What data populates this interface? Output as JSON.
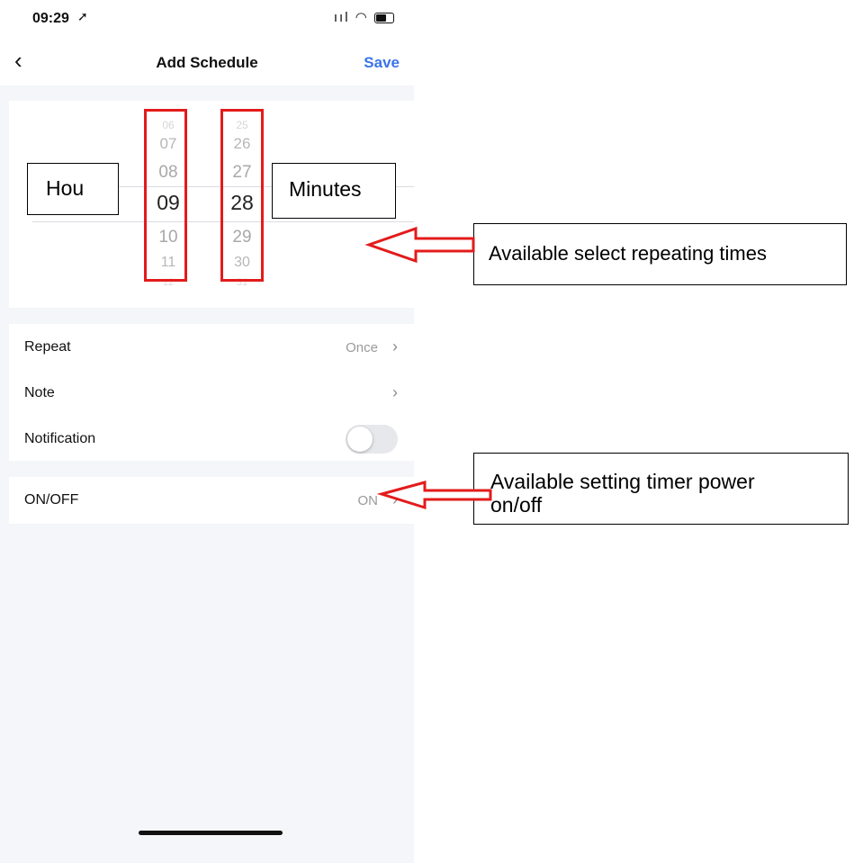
{
  "status_bar": {
    "time": "09:29",
    "location_icon": "location-arrow-icon",
    "signal_icon": "signal-icon",
    "wifi_icon": "wifi-icon",
    "battery_icon": "battery-icon"
  },
  "nav": {
    "back_icon": "chevron-left-icon",
    "title": "Add Schedule",
    "save": "Save"
  },
  "picker": {
    "hours": [
      "06",
      "07",
      "08",
      "09",
      "10",
      "11",
      "12"
    ],
    "minutes": [
      "25",
      "26",
      "27",
      "28",
      "29",
      "30",
      "31"
    ],
    "selected_hour": "09",
    "selected_minute": "28"
  },
  "settings": {
    "repeat": {
      "label": "Repeat",
      "value": "Once"
    },
    "note": {
      "label": "Note"
    },
    "notification": {
      "label": "Notification",
      "enabled": false
    },
    "onoff": {
      "label": "ON/OFF",
      "value": "ON"
    }
  },
  "annotations": {
    "hour_label": "Hou",
    "minutes_label": "Minutes",
    "repeat_callout": "Available select repeating times",
    "onoff_callout_line1": "Available setting timer power",
    "onoff_callout_line2": "on/off",
    "highlight_color": "#e31b1b"
  }
}
